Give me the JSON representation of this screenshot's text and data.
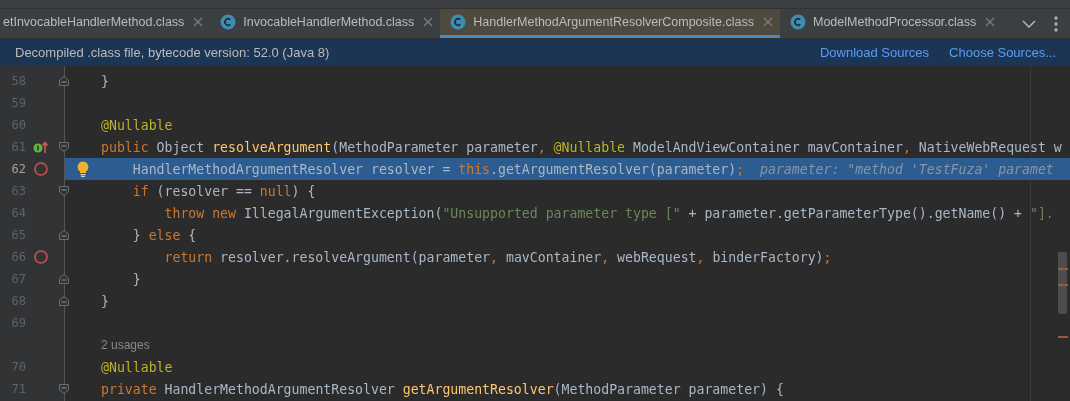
{
  "tabs": [
    {
      "label": "etInvocableHandlerMethod.class",
      "icon": false,
      "selected": false
    },
    {
      "label": "InvocableHandlerMethod.class",
      "icon": true,
      "selected": false
    },
    {
      "label": "HandlerMethodArgumentResolverComposite.class",
      "icon": true,
      "selected": true
    },
    {
      "label": "ModelMethodProcessor.class",
      "icon": true,
      "selected": false
    }
  ],
  "banner": {
    "text": "Decompiled .class file, bytecode version: 52.0 (Java 8)",
    "links": [
      "Download Sources",
      "Choose Sources..."
    ]
  },
  "lines": [
    {
      "number": "58",
      "fold": {
        "kind": "end"
      },
      "tokens": [
        {
          "t": "}",
          "kind": "txt"
        }
      ]
    },
    {
      "number": "59"
    },
    {
      "number": "60",
      "tokens": [
        {
          "t": "@Nullable",
          "kind": "ann"
        }
      ]
    },
    {
      "number": "61",
      "marker": {
        "kind": "override"
      },
      "fold": {
        "kind": "start"
      },
      "tokens": [
        {
          "t": "public ",
          "kind": "kw"
        },
        {
          "t": "Object ",
          "kind": "txt"
        },
        {
          "t": "resolveArgument",
          "kind": "fn"
        },
        {
          "t": "(MethodParameter parameter",
          "kind": "txt"
        },
        {
          "t": ", ",
          "kind": "kw"
        },
        {
          "t": "@Nullable ",
          "kind": "ann"
        },
        {
          "t": "ModelAndViewContainer mavContainer",
          "kind": "txt"
        },
        {
          "t": ", ",
          "kind": "kw"
        },
        {
          "t": "NativeWebRequest w",
          "kind": "txt"
        }
      ]
    },
    {
      "number": "62",
      "marker": {
        "kind": "breakpoint"
      },
      "bulb": true,
      "selected": true,
      "tokens": [
        {
          "t": "    HandlerMethodArgumentResolver resolver = ",
          "kind": "txt"
        },
        {
          "t": "this",
          "kind": "kw"
        },
        {
          "t": ".getArgumentResolver(parameter)",
          "kind": "txt"
        },
        {
          "t": ";",
          "kind": "kw"
        },
        {
          "t": "  parameter: \"method 'TestFuza' paramet",
          "kind": "hint"
        }
      ]
    },
    {
      "number": "63",
      "fold": {
        "kind": "start"
      },
      "tokens": [
        {
          "t": "    if ",
          "kind": "kw"
        },
        {
          "t": "(resolver == ",
          "kind": "txt"
        },
        {
          "t": "null",
          "kind": "kw"
        },
        {
          "t": ") {",
          "kind": "txt"
        }
      ]
    },
    {
      "number": "64",
      "tokens": [
        {
          "t": "        throw new ",
          "kind": "kw"
        },
        {
          "t": "IllegalArgumentException(",
          "kind": "txt"
        },
        {
          "t": "\"Unsupported parameter type [\"",
          "kind": "str"
        },
        {
          "t": " + parameter.getParameterType().getName() + ",
          "kind": "txt"
        },
        {
          "t": "\"].",
          "kind": "str"
        }
      ]
    },
    {
      "number": "65",
      "fold": {
        "kind": "end"
      },
      "tokens": [
        {
          "t": "    } ",
          "kind": "txt"
        },
        {
          "t": "else ",
          "kind": "kw"
        },
        {
          "t": "{",
          "kind": "txt"
        }
      ]
    },
    {
      "number": "66",
      "marker": {
        "kind": "breakpoint"
      },
      "tokens": [
        {
          "t": "        return ",
          "kind": "kw"
        },
        {
          "t": "resolver.resolveArgument(parameter",
          "kind": "txt"
        },
        {
          "t": ", ",
          "kind": "kw"
        },
        {
          "t": "mavContainer",
          "kind": "txt"
        },
        {
          "t": ", ",
          "kind": "kw"
        },
        {
          "t": "webRequest",
          "kind": "txt"
        },
        {
          "t": ", ",
          "kind": "kw"
        },
        {
          "t": "binderFactory)",
          "kind": "txt"
        },
        {
          "t": ";",
          "kind": "kw"
        }
      ]
    },
    {
      "number": "67",
      "fold": {
        "kind": "end"
      },
      "tokens": [
        {
          "t": "    }",
          "kind": "txt"
        }
      ]
    },
    {
      "number": "68",
      "fold": {
        "kind": "end"
      },
      "tokens": [
        {
          "t": "}",
          "kind": "txt"
        }
      ]
    },
    {
      "number": "69"
    },
    {
      "kind": "usages",
      "text": "2 usages"
    },
    {
      "number": "70",
      "tokens": [
        {
          "t": "@Nullable",
          "kind": "ann"
        }
      ]
    },
    {
      "number": "71",
      "fold": {
        "kind": "start"
      },
      "tokens": [
        {
          "t": "private ",
          "kind": "kw"
        },
        {
          "t": "HandlerMethodArgumentResolver ",
          "kind": "txt"
        },
        {
          "t": "getArgumentResolver",
          "kind": "fn"
        },
        {
          "t": "(MethodParameter parameter) {",
          "kind": "txt"
        }
      ]
    }
  ]
}
